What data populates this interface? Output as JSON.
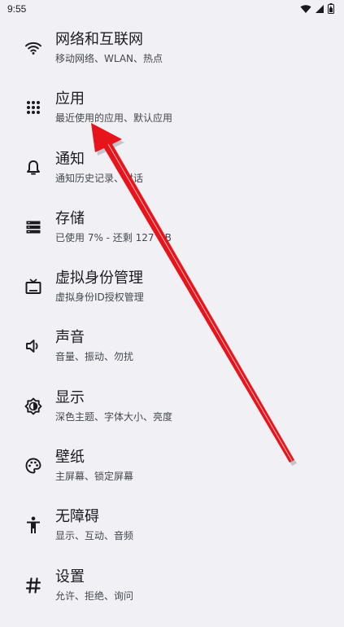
{
  "status_bar": {
    "time": "9:55",
    "icons": [
      "wifi-icon",
      "signal-icon",
      "battery-icon"
    ]
  },
  "settings": {
    "items": [
      {
        "icon": "wifi-icon",
        "title": "网络和互联网",
        "subtitle": "移动网络、WLAN、热点"
      },
      {
        "icon": "apps-icon",
        "title": "应用",
        "subtitle": "最近使用的应用、默认应用"
      },
      {
        "icon": "bell-icon",
        "title": "通知",
        "subtitle": "通知历史记录、对话"
      },
      {
        "icon": "storage-icon",
        "title": "存储",
        "subtitle": "已使用 7% - 还剩 127 GB"
      },
      {
        "icon": "tv-icon",
        "title": "虚拟身份管理",
        "subtitle": "虚拟身份ID授权管理"
      },
      {
        "icon": "volume-icon",
        "title": "声音",
        "subtitle": "音量、振动、勿扰"
      },
      {
        "icon": "brightness-icon",
        "title": "显示",
        "subtitle": "深色主题、字体大小、亮度"
      },
      {
        "icon": "palette-icon",
        "title": "壁纸",
        "subtitle": "主屏幕、锁定屏幕"
      },
      {
        "icon": "accessibility-icon",
        "title": "无障碍",
        "subtitle": "显示、互动、音频"
      },
      {
        "icon": "hash-icon",
        "title": "设置",
        "subtitle": "允许、拒绝、询问"
      }
    ]
  },
  "annotation": {
    "color": "#e8141c",
    "icon": "red-arrow-icon"
  }
}
